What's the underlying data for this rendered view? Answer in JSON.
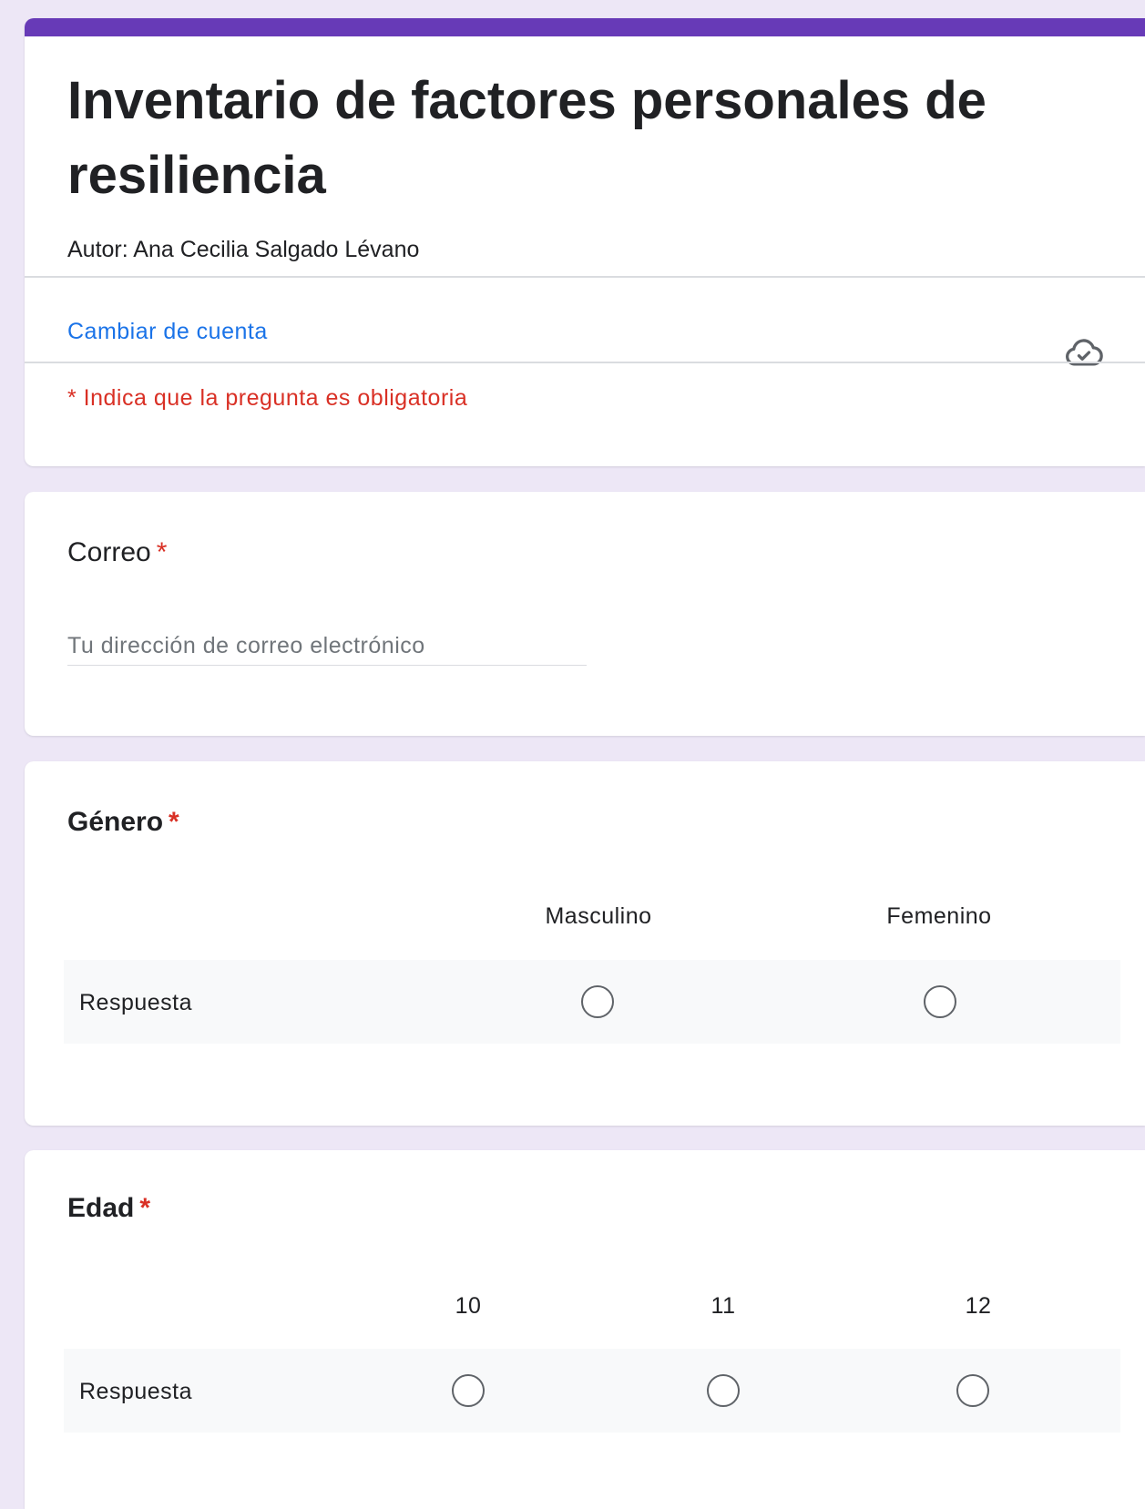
{
  "header": {
    "title": "Inventario de factores personales de resiliencia",
    "description": "Autor: Ana Cecilia Salgado Lévano",
    "switch_account": "Cambiar de cuenta",
    "required_note": "* Indica que la pregunta es obligatoria"
  },
  "colors": {
    "accent": "#673ab7",
    "background": "#ede7f6",
    "link": "#1a73e8",
    "required": "#d93025"
  },
  "icons": {
    "cloud": "cloud-check-icon"
  },
  "questions": {
    "email": {
      "title": "Correo",
      "required_mark": "*",
      "placeholder": "Tu dirección de correo electrónico"
    },
    "gender": {
      "title": "Género",
      "required_mark": "*",
      "columns": [
        "Masculino",
        "Femenino"
      ],
      "row_label": "Respuesta"
    },
    "age": {
      "title": "Edad",
      "required_mark": "*",
      "columns": [
        "10",
        "11",
        "12"
      ],
      "row_label": "Respuesta"
    }
  }
}
